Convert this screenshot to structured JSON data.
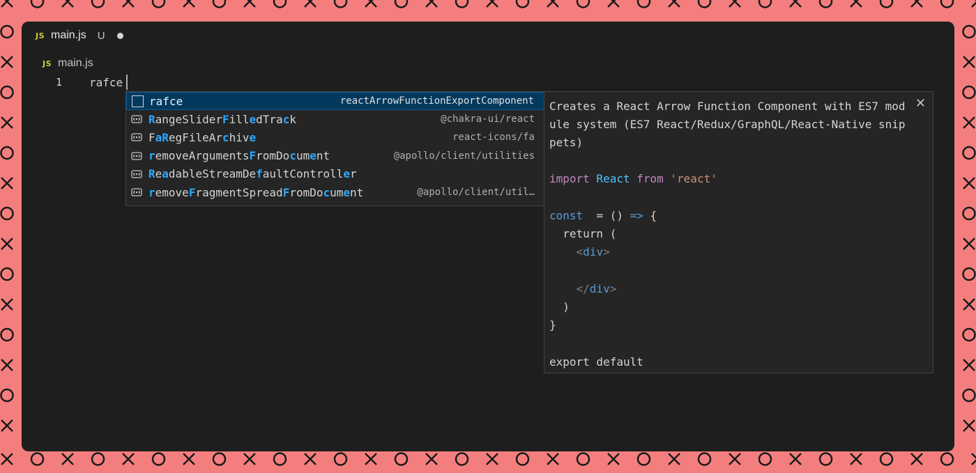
{
  "tab": {
    "icon": "JS",
    "filename": "main.js",
    "status": "U"
  },
  "breadcrumb": {
    "icon": "JS",
    "filename": "main.js"
  },
  "editor": {
    "line_number": "1",
    "code": "rafce"
  },
  "suggestions": [
    {
      "label_parts": [
        [
          "r",
          0
        ],
        [
          "a",
          0
        ],
        [
          "f",
          0
        ],
        [
          "c",
          0
        ],
        [
          "e",
          0
        ]
      ],
      "label": "rafce",
      "detail": "reactArrowFunctionExportComponent",
      "icon": "snippet-icon",
      "selected": true
    },
    {
      "label_parts": [
        [
          "R",
          1
        ],
        [
          "angeSlider",
          0
        ],
        [
          "F",
          1
        ],
        [
          "ill",
          0
        ],
        [
          "e",
          1
        ],
        [
          "dTra",
          0
        ],
        [
          "c",
          1
        ],
        [
          "k",
          0
        ]
      ],
      "label": "RangeSliderFilledTrack",
      "detail": "@chakra-ui/react",
      "icon": "module-icon"
    },
    {
      "label_parts": [
        [
          "F",
          0
        ],
        [
          "a",
          1
        ],
        [
          "R",
          1
        ],
        [
          "egFileAr",
          0
        ],
        [
          "c",
          1
        ],
        [
          "hiv",
          0
        ],
        [
          "e",
          1
        ]
      ],
      "label": "FaRegFileArchive",
      "detail": "react-icons/fa",
      "icon": "module-icon"
    },
    {
      "label_parts": [
        [
          "r",
          1
        ],
        [
          "emoveArguments",
          0
        ],
        [
          "F",
          1
        ],
        [
          "romDo",
          0
        ],
        [
          "c",
          1
        ],
        [
          "um",
          0
        ],
        [
          "e",
          1
        ],
        [
          "nt",
          0
        ]
      ],
      "label": "removeArgumentsFromDocument",
      "detail": "@apollo/client/utilities",
      "icon": "module-icon"
    },
    {
      "label_parts": [
        [
          "R",
          1
        ],
        [
          "e",
          0
        ],
        [
          "a",
          1
        ],
        [
          "dableStreamDe",
          0
        ],
        [
          "f",
          1
        ],
        [
          "aultControll",
          0
        ],
        [
          "e",
          1
        ],
        [
          "r",
          0
        ]
      ],
      "label": "ReadableStreamDefaultController",
      "detail": "",
      "icon": "module-icon"
    },
    {
      "label_parts": [
        [
          "r",
          1
        ],
        [
          "emove",
          0
        ],
        [
          "F",
          1
        ],
        [
          "ragmentSpread",
          0
        ],
        [
          "F",
          1
        ],
        [
          "romDo",
          0
        ],
        [
          "c",
          1
        ],
        [
          "um",
          0
        ],
        [
          "e",
          1
        ],
        [
          "nt",
          0
        ]
      ],
      "label": "removeFragmentSpreadFromDocument",
      "detail": "@apollo/client/util…",
      "icon": "module-icon"
    }
  ],
  "details": {
    "description": "Creates a React Arrow Function Component with ES7 module system (ES7 React/Redux/GraphQL/React-Native snippets)",
    "close": "✕",
    "code_lines": [
      [
        [
          "import",
          "imp"
        ],
        [
          " React ",
          "vt"
        ],
        [
          "from",
          "imp"
        ],
        [
          " ",
          "fg"
        ],
        [
          "'react'",
          "str"
        ]
      ],
      [],
      [
        [
          "const",
          "kw"
        ],
        [
          "  = () ",
          "fg"
        ],
        [
          "=>",
          "kw"
        ],
        [
          " {",
          "fg"
        ]
      ],
      [
        [
          "  return (",
          "fg"
        ]
      ],
      [
        [
          "    ",
          "fg"
        ],
        [
          "<",
          "tagc"
        ],
        [
          "div",
          "tagn"
        ],
        [
          ">",
          "tagc"
        ]
      ],
      [],
      [
        [
          "    ",
          "fg"
        ],
        [
          "</",
          "tagc"
        ],
        [
          "div",
          "tagn"
        ],
        [
          ">",
          "tagc"
        ]
      ],
      [
        [
          "  )",
          "fg"
        ]
      ],
      [
        [
          "}",
          "fg"
        ]
      ],
      [],
      [
        [
          "export default",
          "fg"
        ]
      ]
    ]
  },
  "colors": {
    "frame": "#f47e7e",
    "editor_bg": "#1e1e1e",
    "selection": "#04395e",
    "match": "#2aaaff"
  }
}
